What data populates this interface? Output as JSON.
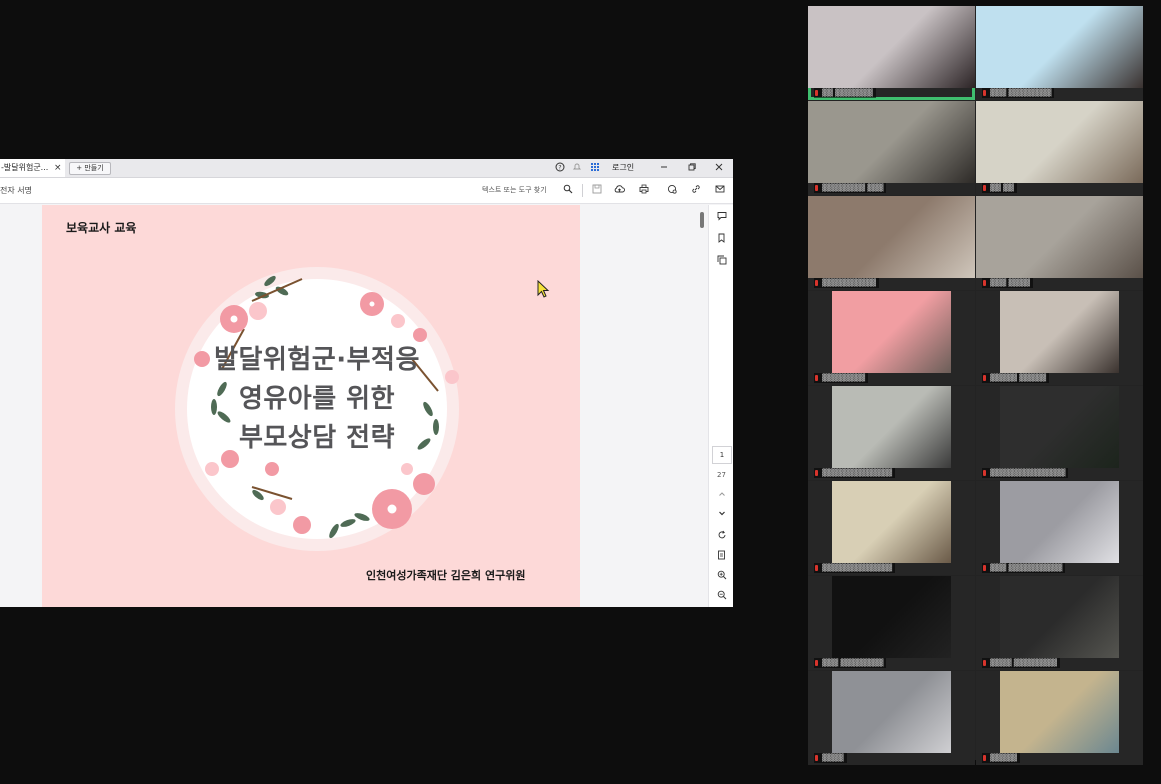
{
  "pdf_viewer": {
    "tab_label": "-발달위험군...",
    "tab_close": "×",
    "new_tab_label": "+ 만들기",
    "login_label": "로그인",
    "esign_label": "전자 서명",
    "find_placeholder": "텍스트 또는 도구 찾기",
    "page_current": "1",
    "page_total": "27",
    "window_controls": [
      "minimize-icon",
      "restore-icon",
      "close-icon"
    ],
    "toolbar_icons": [
      "search-icon",
      "save-icon",
      "cloud-upload-icon",
      "print-icon",
      "share-icon",
      "link-icon",
      "mail-icon"
    ],
    "rail_icons": [
      "comment-icon",
      "bookmark-icon",
      "copy-icon",
      "chevron-up-icon",
      "chevron-down-icon",
      "rotate-icon",
      "extract-icon",
      "zoom-in-icon",
      "zoom-out-icon"
    ]
  },
  "slide": {
    "header": "보육교사 교육",
    "title_line1": "발달위험군·부적응",
    "title_line2": "영유아를 위한",
    "title_line3": "부모상담 전략",
    "author": "인천여성가족재단 김은희 연구위원",
    "background_color": "#fdd9d8"
  },
  "gallery": {
    "accent_active": "#3fbf6f",
    "participants": [
      {
        "name": "▓▓ ▓▓▓▓▓▓▓",
        "active": true
      },
      {
        "name": "▓▓▓ ▓▓▓▓▓▓▓▓"
      },
      {
        "name": "▓▓▓▓▓▓▓▓ ▓▓▓"
      },
      {
        "name": "▓▓ ▓▓"
      },
      {
        "name": "▓▓▓▓▓▓▓▓▓▓"
      },
      {
        "name": "▓▓▓ ▓▓▓▓"
      },
      {
        "name": "▓▓▓▓▓▓▓▓"
      },
      {
        "name": "▓▓▓▓▓ ▓▓▓▓▓"
      },
      {
        "name": "▓▓▓▓▓▓▓▓▓▓▓▓▓"
      },
      {
        "name": "▓▓▓▓▓▓▓▓▓▓▓▓▓▓"
      },
      {
        "name": "▓▓▓▓▓▓▓▓▓▓▓▓▓"
      },
      {
        "name": "▓▓▓ ▓▓▓▓▓▓▓▓▓▓"
      },
      {
        "name": "▓▓▓ ▓▓▓▓▓▓▓▓"
      },
      {
        "name": "▓▓▓▓ ▓▓▓▓▓▓▓▓"
      },
      {
        "name": "▓▓▓▓"
      },
      {
        "name": "▓▓▓▓▓"
      }
    ]
  }
}
